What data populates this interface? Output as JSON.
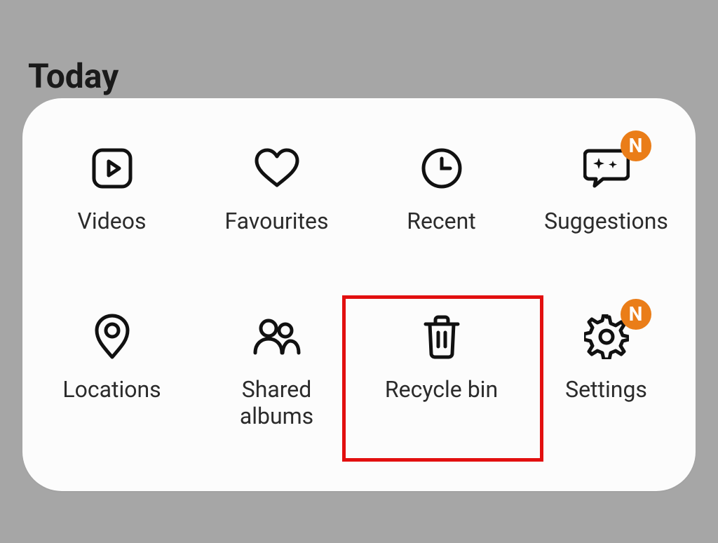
{
  "section_title": "Today",
  "badge_text": "N",
  "colors": {
    "accent": "#ea7d18",
    "highlight": "#e20f0f"
  },
  "tiles": {
    "videos": {
      "label": "Videos"
    },
    "favourites": {
      "label": "Favourites"
    },
    "recent": {
      "label": "Recent"
    },
    "suggestions": {
      "label": "Suggestions"
    },
    "locations": {
      "label": "Locations"
    },
    "shared": {
      "label": "Shared albums"
    },
    "recycle": {
      "label": "Recycle bin"
    },
    "settings": {
      "label": "Settings"
    }
  }
}
